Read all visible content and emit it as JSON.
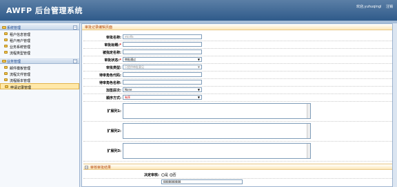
{
  "header": {
    "app_title": "AWFP 后台管理系统",
    "welcome": "欢迎,yuhuqingl",
    "logout": "注销"
  },
  "sidebar": {
    "groups": [
      {
        "title": "系统管理",
        "items": [
          "租户信息管理",
          "租户用户管理",
          "业务系统管理",
          "流程类型管理"
        ]
      },
      {
        "title": "业务管理",
        "items": [
          "邮件模板管理",
          "流程文件管理",
          "流程版本管理",
          "申请记录管理"
        ],
        "active_index": 3
      }
    ]
  },
  "main": {
    "page_title": "审批记录编辑页面",
    "fields": {
      "name": {
        "label": "审批名称:",
        "value": "etcdfa"
      },
      "title": {
        "label": "审批标题:",
        "required": "*"
      },
      "initiator": {
        "label": "被指定名称:"
      },
      "status": {
        "label": "审批状态:",
        "required": "*",
        "value": "审批通过"
      },
      "type": {
        "label": "审批类型:",
        "value": "只提供审批意见"
      },
      "role_code": {
        "label": "待审角色代码:"
      },
      "role_name": {
        "label": "待审角色名称:"
      },
      "add_level": {
        "label": "加签层次:",
        "value": "None"
      },
      "order": {
        "label": "顺序方式:",
        "value": "有序"
      },
      "ext1": {
        "label": "扩展列1:"
      },
      "ext2": {
        "label": "扩展列2:"
      },
      "ext3": {
        "label": "扩展列3:"
      }
    },
    "result_section": "审核审批结果",
    "decide": {
      "label": "决定审核:",
      "yes": "是",
      "no": "否"
    },
    "next_field_value": "8888888888"
  }
}
